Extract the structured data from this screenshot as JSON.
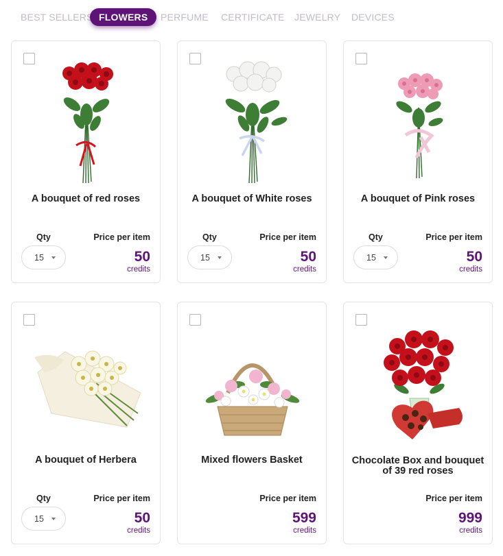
{
  "tabs": [
    {
      "label": "BEST SELLERS",
      "active": false
    },
    {
      "label": "FLOWERS",
      "active": true
    },
    {
      "label": "PERFUME",
      "active": false
    },
    {
      "label": "CERTIFICATE",
      "active": false
    },
    {
      "label": "JEWELRY",
      "active": false
    },
    {
      "label": "DEVICES",
      "active": false
    }
  ],
  "colors": {
    "accent": "#5e1377",
    "inactive_tab": "#c2bdc4"
  },
  "labels": {
    "qty": "Qty",
    "price_per_item": "Price per item",
    "unit": "credits"
  },
  "products": [
    {
      "title": "A bouquet of red roses",
      "image": "red-roses-bouquet",
      "qty": "15",
      "price": "50",
      "checked": false
    },
    {
      "title": "A bouquet of White roses",
      "image": "white-roses-bouquet",
      "qty": "15",
      "price": "50",
      "checked": false
    },
    {
      "title": "A bouquet of Pink roses",
      "image": "pink-roses-bouquet",
      "qty": "15",
      "price": "50",
      "checked": false
    },
    {
      "title": "A bouquet of Herbera",
      "image": "gerbera-bouquet",
      "qty": "15",
      "price": "50",
      "checked": false
    },
    {
      "title": "Mixed flowers Basket",
      "image": "flower-basket",
      "price": "599",
      "checked": false
    },
    {
      "title": "Chocolate Box and bouquet of 39 red roses",
      "image": "roses-and-chocolate-box",
      "price": "999",
      "checked": false
    }
  ]
}
